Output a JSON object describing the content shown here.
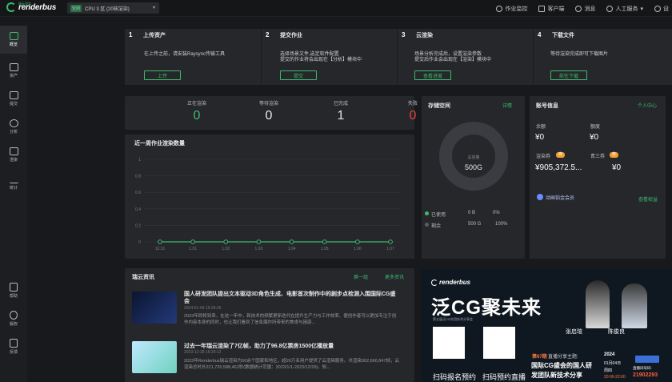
{
  "brand": {
    "name": "renderbus",
    "sub": "瑞云渲染"
  },
  "topbar": {
    "zone_tag": "空闲",
    "zone_label": "CPU 3 区 (20核渲染)",
    "items": [
      {
        "label": "作业监控",
        "icon": "monitor-icon"
      },
      {
        "label": "客户端",
        "icon": "client-icon"
      },
      {
        "label": "消息",
        "icon": "bell-icon"
      },
      {
        "label": "人工服务",
        "icon": "headset-icon"
      },
      {
        "label": "设",
        "icon": "settings-icon"
      }
    ]
  },
  "sidebar": {
    "top": [
      {
        "label": "概览",
        "icon": "overview-icon",
        "active": true
      },
      {
        "label": "资产",
        "icon": "asset-icon"
      },
      {
        "label": "提交",
        "icon": "submit-icon"
      },
      {
        "label": "分析",
        "icon": "analyze-icon"
      },
      {
        "label": "渲染",
        "icon": "render-icon"
      },
      {
        "label": "统计",
        "icon": "stats-icon"
      }
    ],
    "bottom": [
      {
        "label": "帮助",
        "icon": "help-icon"
      },
      {
        "label": "版权",
        "icon": "copyright-icon"
      },
      {
        "label": "反馈",
        "icon": "feedback-icon"
      }
    ]
  },
  "steps": [
    {
      "num": "1",
      "title": "上传资产",
      "line1": "在上传之前，请安装Raysync传输工具",
      "line2": "",
      "button": "上传"
    },
    {
      "num": "2",
      "title": "提交作业",
      "line1": "选择场景文件,选定软件配置",
      "line2": "提交的作业将会出现在【分析】模块中",
      "button": "提交"
    },
    {
      "num": "3",
      "title": "云渲染",
      "line1": "场景分析完成后，设置渲染参数",
      "line2": "提交后作业会出现在【渲染】模块中",
      "button": "查看进度"
    },
    {
      "num": "4",
      "title": "下载文件",
      "line1": "等待渲染完成即可下载图片",
      "line2": "",
      "button": "前往下载"
    }
  ],
  "stats": [
    {
      "label": "正在渲染",
      "value": "0",
      "color": "#3dba6d"
    },
    {
      "label": "等待渲染",
      "value": "0",
      "color": "#e6e6e6"
    },
    {
      "label": "已完成",
      "value": "1",
      "color": "#e6e6e6"
    },
    {
      "label": "失败",
      "value": "0",
      "color": "#e0453a"
    }
  ],
  "chart_title": "近一周作业渲染数量",
  "chart_data": {
    "type": "line",
    "categories": [
      "12.31",
      "1.01",
      "1.02",
      "1.03",
      "1.04",
      "1.05",
      "1.06",
      "1.07"
    ],
    "values": [
      0,
      0,
      0,
      0,
      0,
      0,
      0,
      0
    ],
    "ylim": [
      0,
      1
    ],
    "yticks": [
      "0",
      "0.2",
      "0.4",
      "0.6",
      "0.8",
      "1"
    ],
    "grid": true
  },
  "storage": {
    "title": "存储空间",
    "detail": "详情",
    "center_label": "总容量",
    "center_value": "500G",
    "used_label": "已使用",
    "used_value": "0 B",
    "used_pct": "0%",
    "free_label": "剩余",
    "free_value": "500 G",
    "free_pct": "100%",
    "used_fraction": 0
  },
  "account": {
    "title": "账号信息",
    "center": "个人中心",
    "balance_label": "余额",
    "balance_value": "¥0",
    "quota_label": "额度",
    "quota_value": "¥0",
    "coupon_label": "渲染券",
    "coupon_value": "¥905,372.5...",
    "third_label": "青三券",
    "third_value": "¥0",
    "member_label": "动画铂金会员",
    "member_link": "查看权益"
  },
  "news": {
    "title": "瑞云资讯",
    "refresh": "换一组",
    "more": "更多资讯",
    "items": [
      {
        "title": "国人研发团队提出文本驱动3D角色生成、电影首次制作中的剧步点检测入围国际CG盛会",
        "date": "2024-01-04 15:34:26",
        "desc": "2023年即将到来，在这一年中，新技术的频繁更新迭代在提升生产力与工作效率、便创作者可以更加专注于创作内容本身的同时，也让我们看到了信息爆炸所带来的焦虑与困惑..."
      },
      {
        "title": "过去一年瑞云渲染了7亿帧，助力了96.8亿票房1500亿播放量",
        "date": "2023-12-28 16:29:12",
        "desc": "2023年Renderbus瑞云渲染为50余个国家和地区，超26万名用户提供了云渲染服务。共渲染362,666,847帧，云渲染总时长221,726,588,462秒(数据统计范围：2023/1/1-2023/12/29)。知..."
      }
    ]
  },
  "banner": {
    "brand": "renderbus",
    "headline": "泛CG聚未来",
    "subline": "第五届泛CG实用技术分享会",
    "scan1": "扫码报名预约",
    "scan2": "扫码预约直播",
    "speaker1": "张启瑄",
    "speaker2": "陈俊良",
    "episode": "第67期",
    "episode_suffix": "直播分享主题:",
    "topic_l1": "国际CG盛会的国人研",
    "topic_l2": "发团队新技术分享",
    "year": "2024",
    "date": "01月04日",
    "weekday": "周四",
    "time": "20:00-22:00",
    "room_label": "直播间号码:",
    "room": "21902293"
  }
}
